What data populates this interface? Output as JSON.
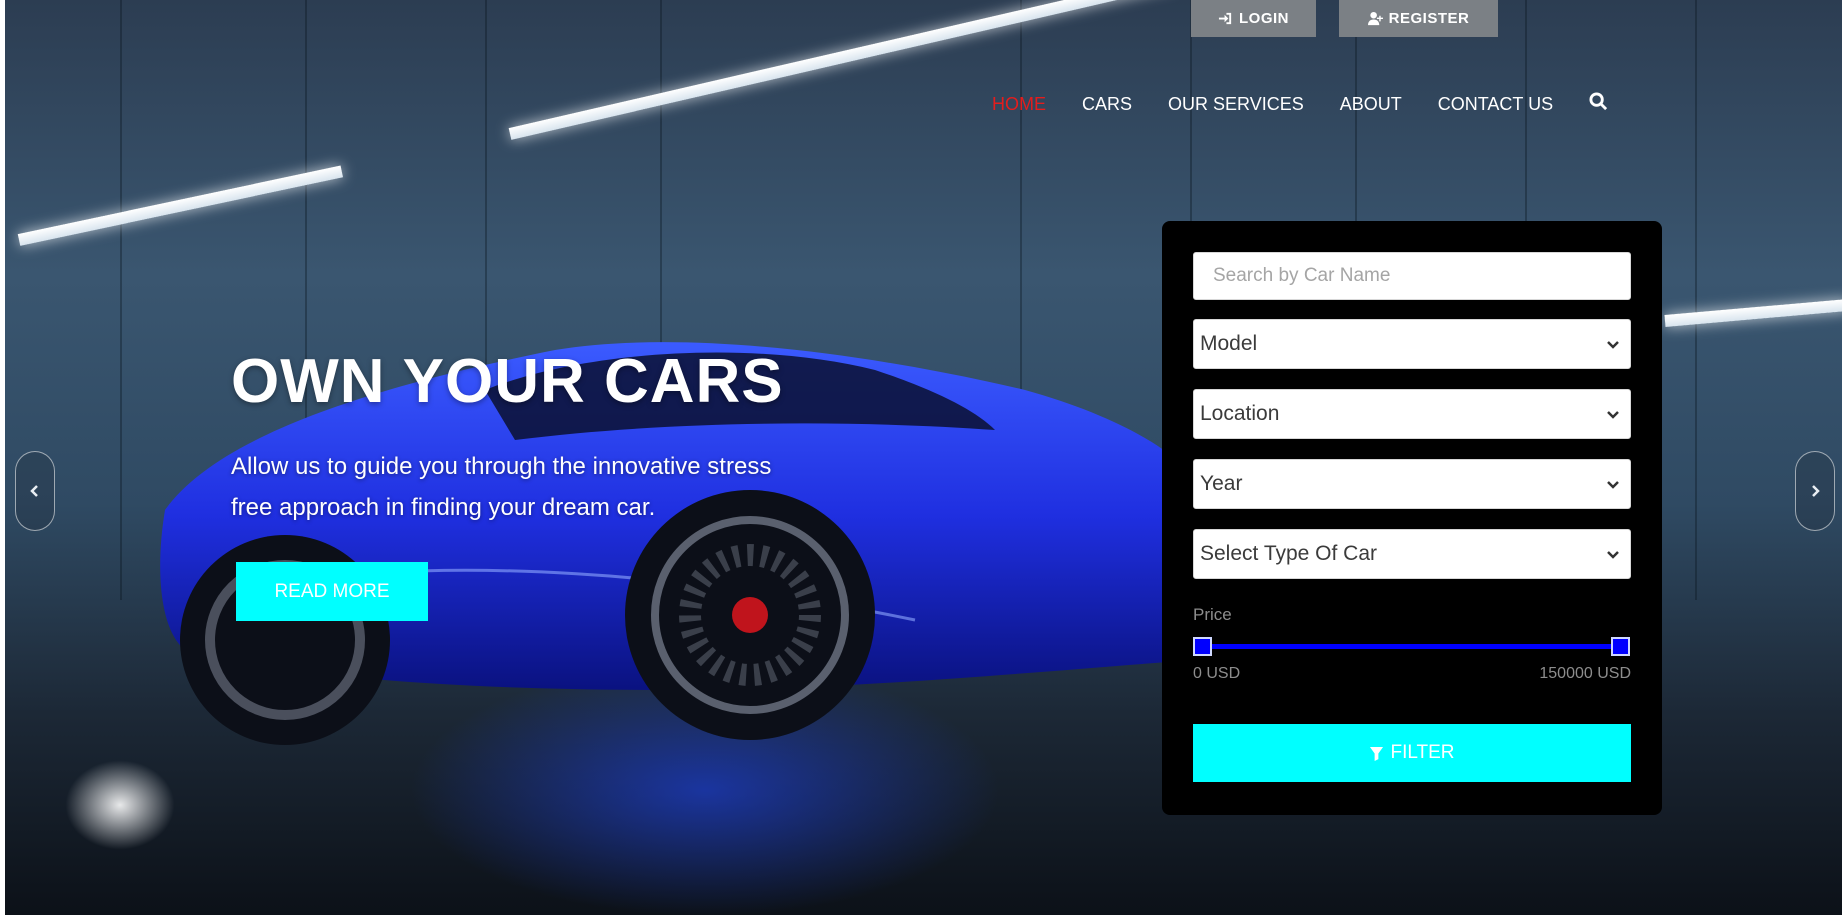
{
  "auth": {
    "login_label": "LOGIN",
    "register_label": "REGISTER"
  },
  "nav": {
    "items": [
      "HOME",
      "CARS",
      "OUR SERVICES",
      "ABOUT",
      "CONTACT US"
    ],
    "active_index": 0,
    "active_color": "#e41d1d"
  },
  "hero": {
    "title": "OWN YOUR CARS",
    "subtitle": "Allow us to guide you through the innovative stress free approach in finding your dream car.",
    "button_label": "READ MORE",
    "accent_color": "#00ffff"
  },
  "filter": {
    "search_placeholder": "Search by Car Name",
    "model_selected": "Model",
    "location_selected": "Location",
    "year_selected": "Year",
    "type_selected": "Select Type Of Car",
    "price_label": "Price",
    "price_min_label": "0 USD",
    "price_max_label": "150000 USD",
    "price_min_value": 0,
    "price_max_value": 150000,
    "slider_color": "#0000ff",
    "button_label": "FILTER"
  },
  "icons": {
    "login": "sign-in-icon",
    "register": "user-plus-icon",
    "search": "search-icon",
    "filter": "filter-icon",
    "prev": "chevron-left-icon",
    "next": "chevron-right-icon"
  }
}
